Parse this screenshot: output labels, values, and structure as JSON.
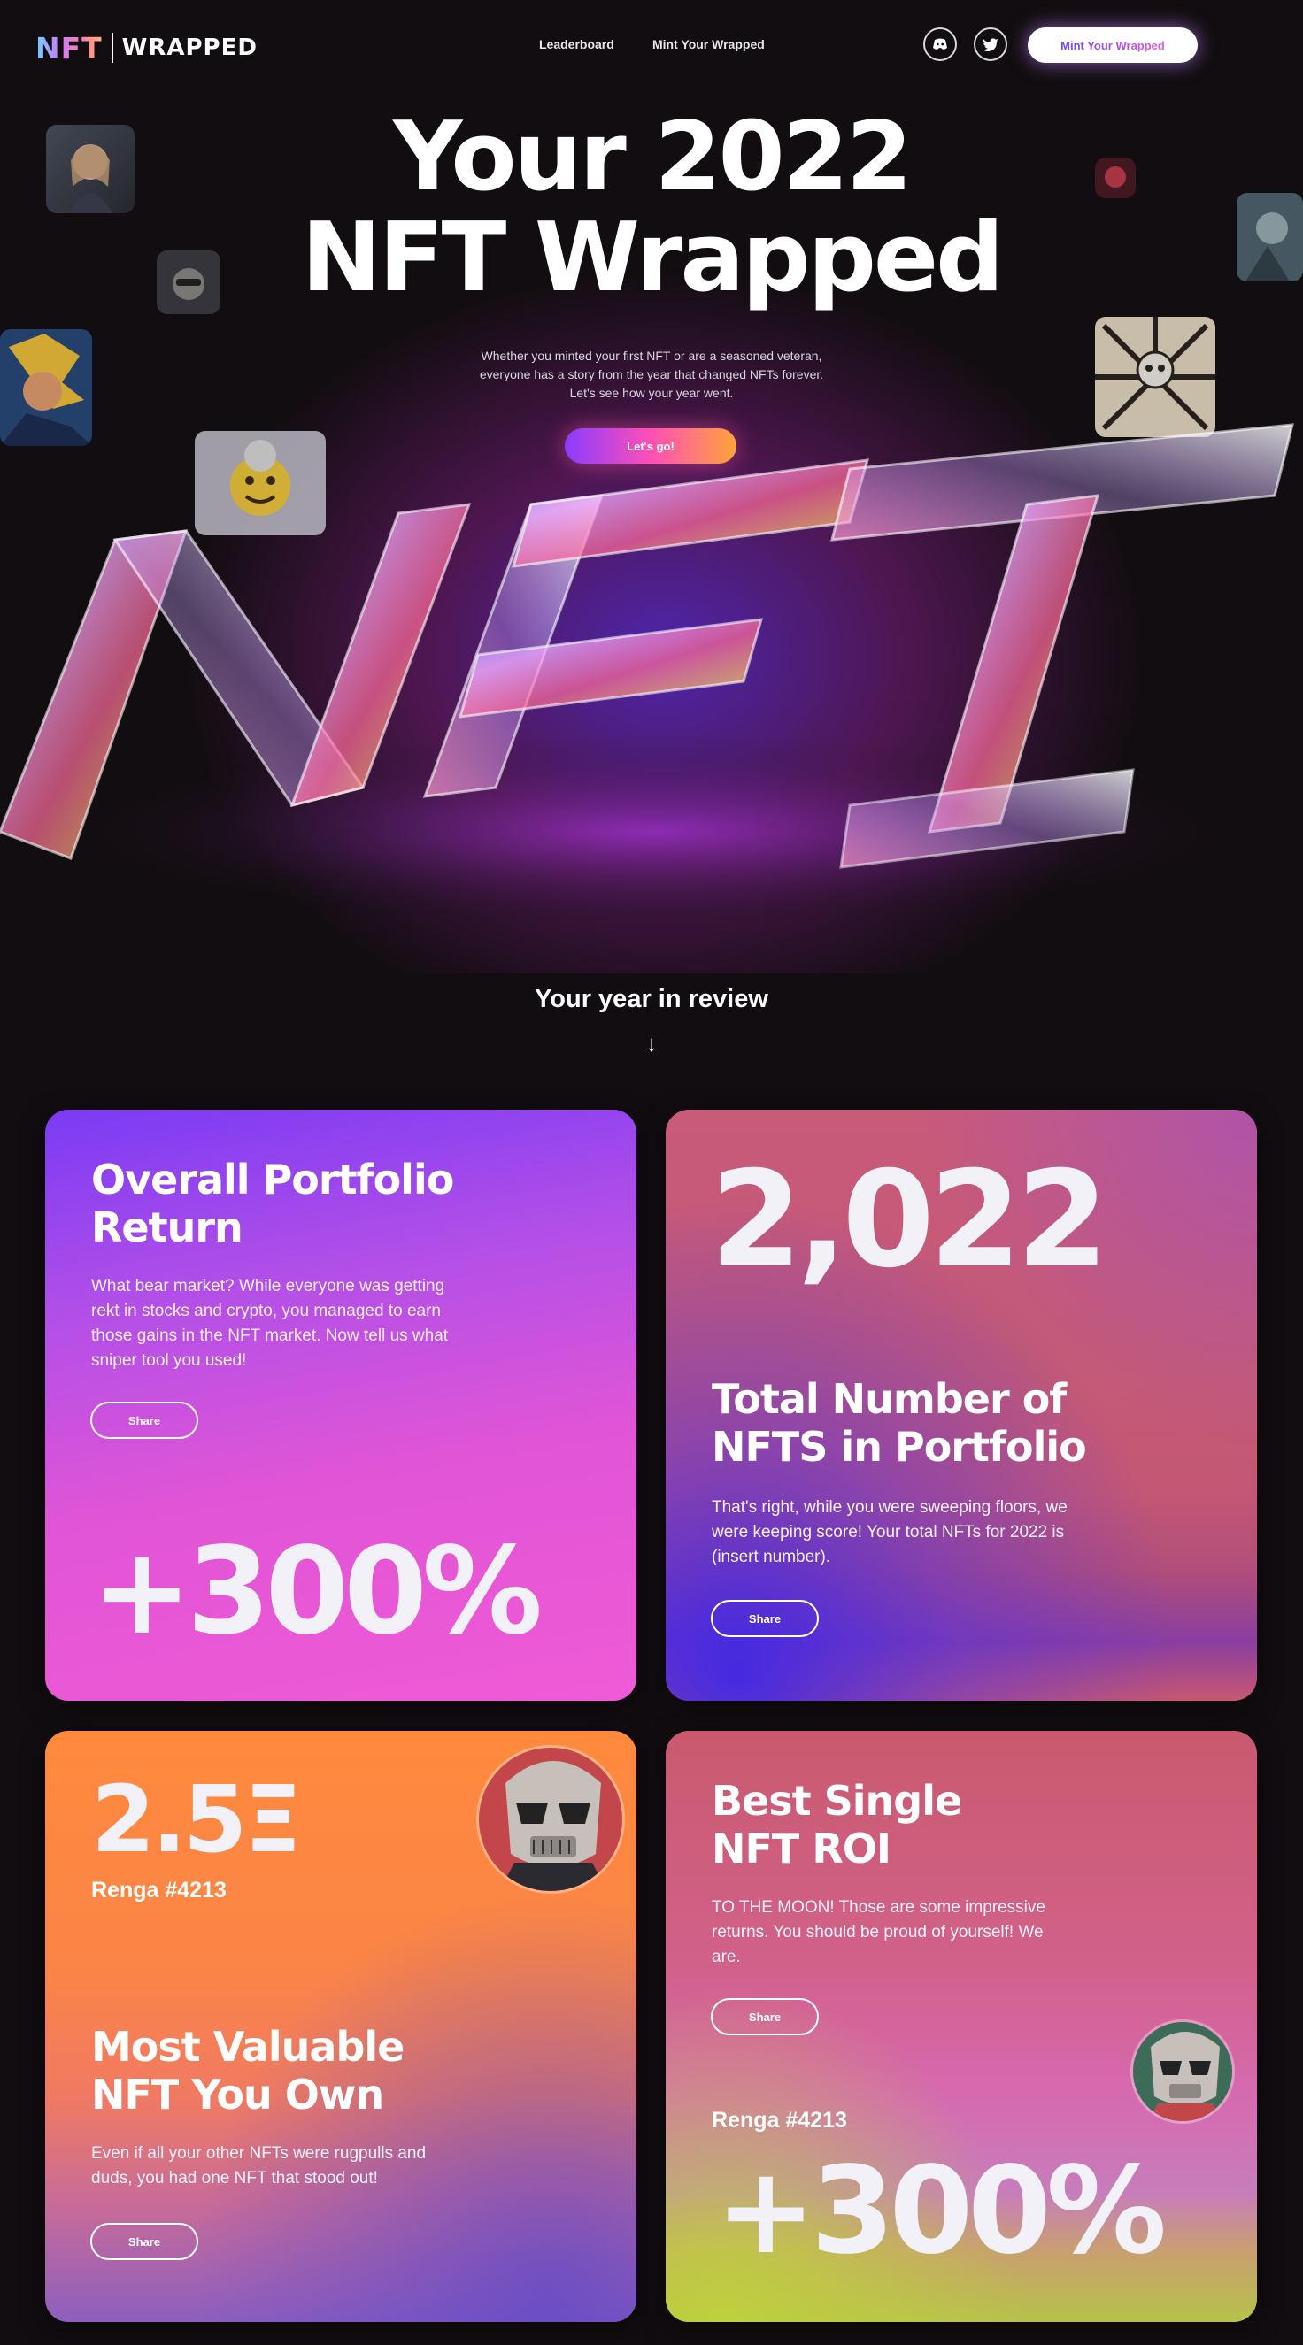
{
  "brand": {
    "logo_mark": "NFT",
    "logo_word": "WRAPPED"
  },
  "nav": {
    "links": [
      "Leaderboard",
      "Mint Your Wrapped"
    ],
    "icons": [
      "discord-icon",
      "twitter-icon"
    ],
    "cta": "Mint Your Wrapped"
  },
  "hero": {
    "title_line1": "Your 2022",
    "title_line2": "NFT Wrapped",
    "subtitle_line1": "Whether you minted your first NFT or are a seasoned veteran,",
    "subtitle_line2": "everyone has a story from the year that changed NFTs forever.",
    "subtitle_line3": "Let's see how your year went.",
    "cta": "Let's go!",
    "sculpture_text": "NFT"
  },
  "review": {
    "heading": "Your year in review",
    "arrow": "↓"
  },
  "cards": {
    "portfolio": {
      "title_line1": "Overall Portfolio",
      "title_line2": "Return",
      "body_line1": "What bear market? While everyone was getting",
      "body_line2": "rekt in stocks and crypto, you managed to earn",
      "body_line3": "those gains in the NFT market. Now tell us what",
      "body_line4": "sniper tool you used!",
      "share": "Share",
      "value": "+300%"
    },
    "total": {
      "value": "2,022",
      "title_line1": "Total Number of",
      "title_line2": "NFTS in Portfolio",
      "body_line1": "That's right, while you were sweeping floors, we",
      "body_line2": "were keeping score! Your total NFTs for 2022 is",
      "body_line3": "(insert number).",
      "share": "Share"
    },
    "valuable": {
      "value": "2.5Ξ",
      "token": "Renga #4213",
      "title_line1": "Most Valuable",
      "title_line2": "NFT You Own",
      "body_line1": "Even if all your other NFTs were rugpulls and",
      "body_line2": "duds, you had one NFT that stood out!",
      "share": "Share"
    },
    "roi": {
      "title_line1": "Best Single",
      "title_line2": "NFT ROI",
      "body_line1": "TO THE MOON! Those are some impressive",
      "body_line2": "returns. You should be proud of yourself! We",
      "body_line3": "are.",
      "share": "Share",
      "token": "Renga #4213",
      "value": "+300%"
    }
  },
  "colors": {
    "background": "#120d10",
    "accent_purple": "#7b3cff",
    "accent_pink": "#f05ad6",
    "accent_orange": "#ff8a3d"
  }
}
